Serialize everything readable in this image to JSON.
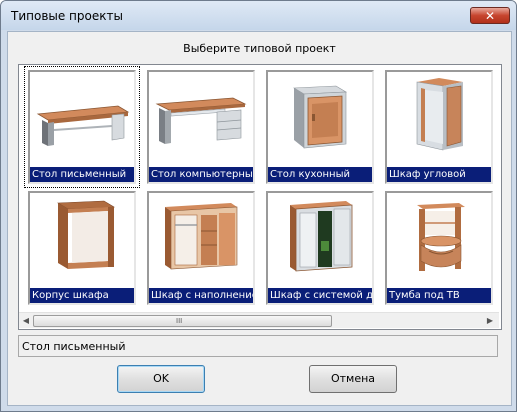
{
  "window": {
    "title": "Типовые проекты",
    "close_glyph": "✕"
  },
  "prompt": "Выберите типовой проект",
  "projects": [
    {
      "label": "Стол письменный",
      "icon": "desk-icon"
    },
    {
      "label": "Стол компьютерный",
      "icon": "computer-desk-icon"
    },
    {
      "label": "Стол кухонный",
      "icon": "kitchen-table-icon"
    },
    {
      "label": "Шкаф угловой",
      "icon": "corner-cabinet-icon"
    },
    {
      "label": "Корпус шкафа",
      "icon": "cabinet-frame-icon"
    },
    {
      "label": "Шкаф с наполнением",
      "icon": "filled-wardrobe-icon"
    },
    {
      "label": "Шкаф с системой двер",
      "icon": "sliding-door-wardrobe-icon"
    },
    {
      "label": "Тумба под ТВ",
      "icon": "tv-stand-icon"
    }
  ],
  "selected_index": 0,
  "scrollbar": {
    "left_arrow": "◀",
    "right_arrow": "▶",
    "grip": "III"
  },
  "status_text": "Стол письменный",
  "buttons": {
    "ok": "OK",
    "cancel": "Отмена"
  },
  "colors": {
    "caption_bg": "#0a1e78",
    "wood": "#c7845a",
    "frame": "#dfe4e8"
  }
}
